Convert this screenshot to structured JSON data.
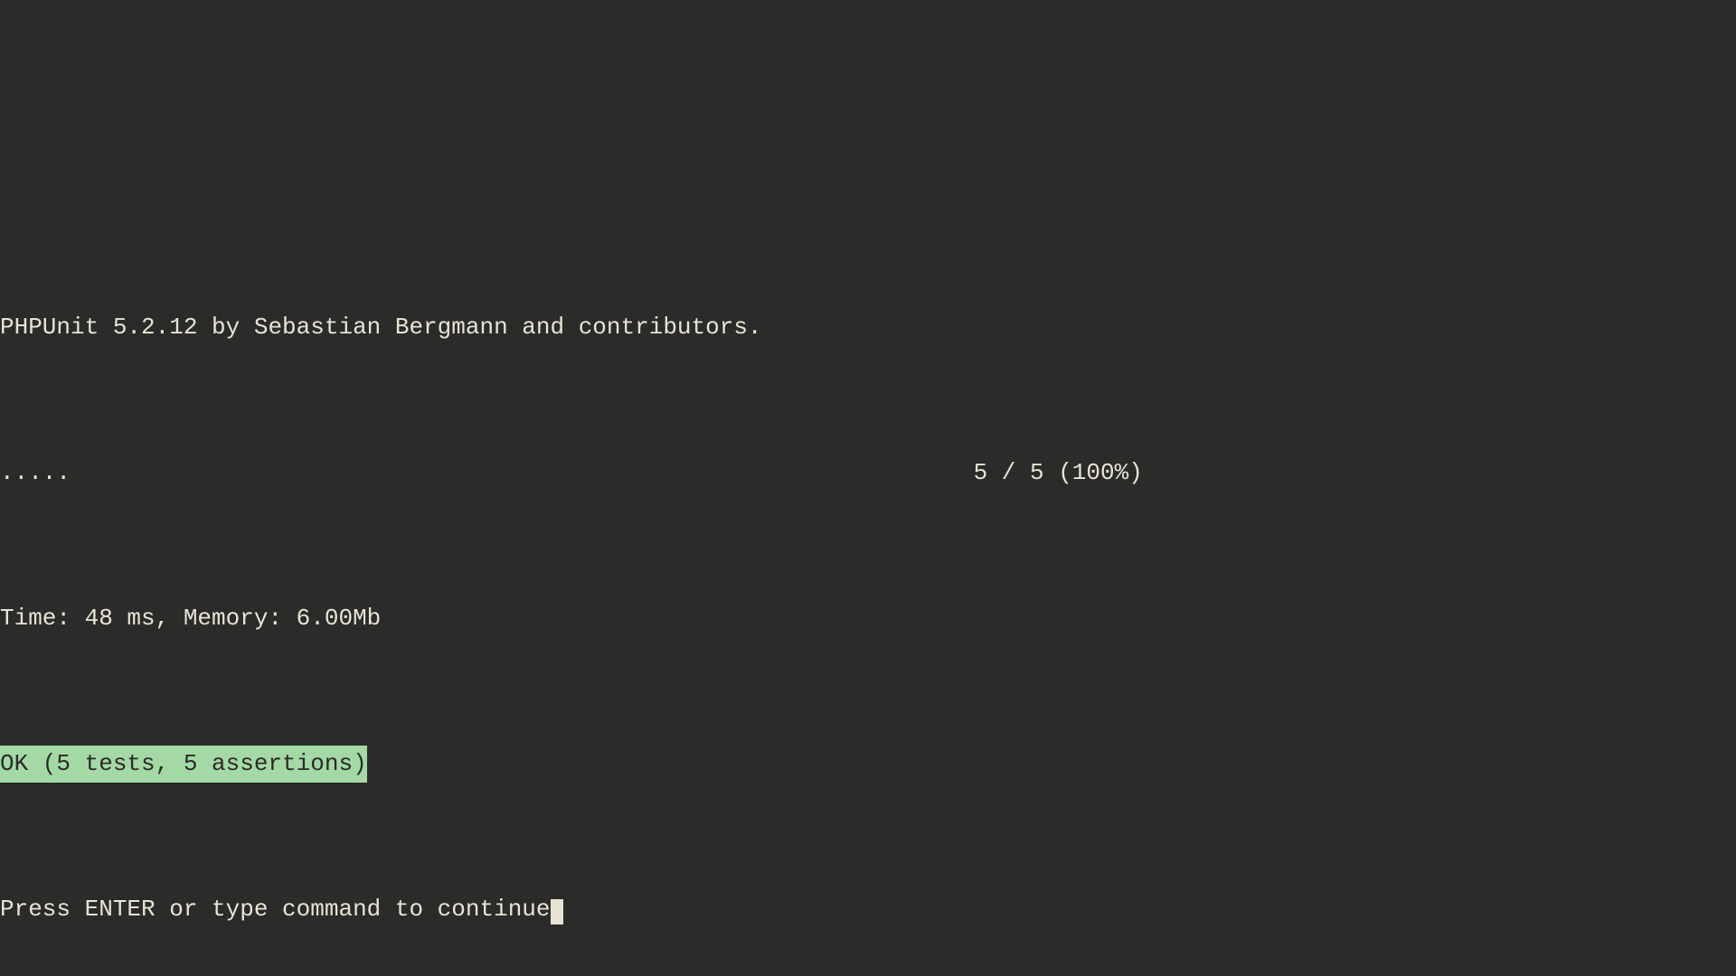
{
  "terminal": {
    "header": "PHPUnit 5.2.12 by Sebastian Bergmann and contributors.",
    "dots": ".....",
    "spacing": "                                                                ",
    "progress": "5 / 5 (100%)",
    "time_memory": "Time: 48 ms, Memory: 6.00Mb",
    "ok_status": "OK (5 tests, 5 assertions)",
    "prompt": "Press ENTER or type command to continue"
  }
}
